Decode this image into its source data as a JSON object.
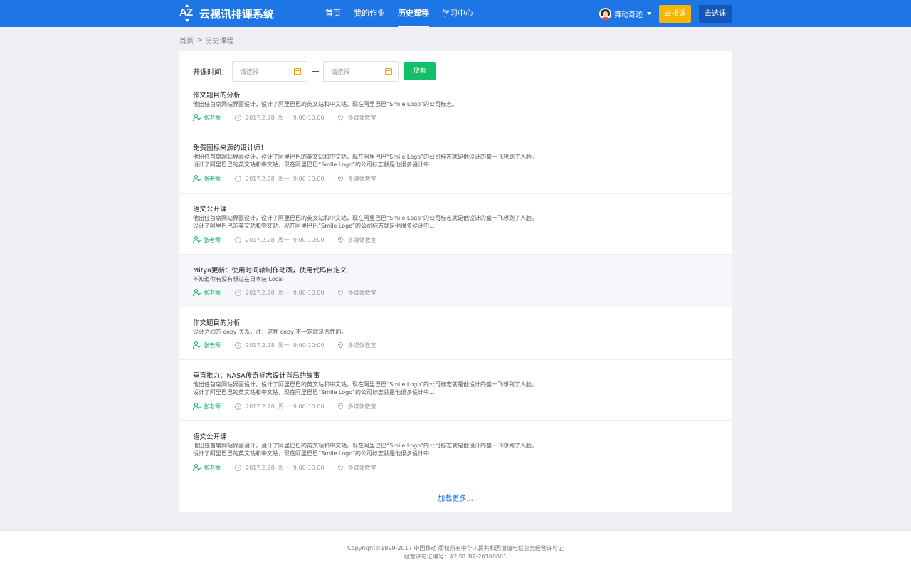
{
  "header": {
    "logo_text": "云视讯排课系统",
    "nav": [
      {
        "label": "首页",
        "active": false
      },
      {
        "label": "我的作业",
        "active": false
      },
      {
        "label": "历史课程",
        "active": true
      },
      {
        "label": "学习中心",
        "active": false
      }
    ],
    "user_name": "舞动奇迹",
    "arrange_button": "去排课",
    "select_button": "去选课",
    "colors": {
      "bar": "#1d75e6",
      "arrange": "#f7b500",
      "select": "#1557b8"
    }
  },
  "breadcrumb": {
    "home": "首页",
    "separator": ">",
    "current": "历史课程"
  },
  "filter": {
    "label": "开课时间：",
    "start_placeholder": "请选择",
    "end_placeholder": "请选择",
    "search_button": "搜索",
    "icon": "calendar-icon"
  },
  "courses": [
    {
      "title": "作文题目的分析",
      "desc_line1": "他出任首席网站界面设计，设计了阿里巴巴的英文站和中文站，现在阿里巴巴“Smile Logo”的公司标志。",
      "desc_line2": "",
      "teacher": "张老师",
      "date": "2017.2.28",
      "weekday": "周一",
      "time": "9:00-10:00",
      "place": "多媒体教室"
    },
    {
      "title": "免费图标来源的设计师！",
      "desc_line1": "他出任首席网站界面设计，设计了阿里巴巴的英文站和中文站，现在阿里巴巴“Smile Logo”的公司标志就是他设计的盛一飞想到了人脸。",
      "desc_line2": "设计了阿里巴巴的英文站和中文站，现在阿里巴巴“Smile Logo”的公司标志就是他很多设计中...",
      "teacher": "张老师",
      "date": "2017.2.28",
      "weekday": "周一",
      "time": "9:00-10:00",
      "place": "多媒体教室"
    },
    {
      "title": "语文公开课",
      "desc_line1": "他出任首席网站界面设计，设计了阿里巴巴的英文站和中文站，现在阿里巴巴“Smile Logo”的公司标志就是他设计的盛一飞想到了人脸。",
      "desc_line2": "设计了阿里巴巴的英文站和中文站，现在阿里巴巴“Smile Logo”的公司标志就是他很多设计中...",
      "teacher": "张老师",
      "date": "2017.2.28",
      "weekday": "周一",
      "time": "9:00-10:00",
      "place": "多媒体教室"
    },
    {
      "title": "Mitya更新：使用时间轴制作动画，使用代码自定义",
      "desc_line1": "不知道你有没有想过在日本装 Local",
      "desc_line2": "",
      "teacher": "张老师",
      "date": "2017.2.28",
      "weekday": "周一",
      "time": "9:00-10:00",
      "place": "多媒体教室"
    },
    {
      "title": "作文题目的分析",
      "desc_line1": "设计之间的 copy 关系，注：这种 copy 不一定就是恶性的。",
      "desc_line2": "",
      "teacher": "张老师",
      "date": "2017.2.28",
      "weekday": "周一",
      "time": "9:00-10:00",
      "place": "多媒体教室"
    },
    {
      "title": "垂直推力：NASA传奇标志设计背后的故事",
      "desc_line1": "他出任首席网站界面设计，设计了阿里巴巴的英文站和中文站，现在阿里巴巴“Smile Logo”的公司标志就是他设计的盛一飞想到了人脸。",
      "desc_line2": "设计了阿里巴巴的英文站和中文站，现在阿里巴巴“Smile Logo”的公司标志就是他很多设计中...",
      "teacher": "张老师",
      "date": "2017.2.28",
      "weekday": "周一",
      "time": "9:00-10:00",
      "place": "多媒体教室"
    },
    {
      "title": "语文公开课",
      "desc_line1": "他出任首席网站界面设计，设计了阿里巴巴的英文站和中文站，现在阿里巴巴“Smile Logo”的公司标志就是他设计的盛一飞想到了人脸。",
      "desc_line2": "设计了阿里巴巴的英文站和中文站，现在阿里巴巴“Smile Logo”的公司标志就是他很多设计中...",
      "teacher": "张老师",
      "date": "2017.2.28",
      "weekday": "周一",
      "time": "9:00-10:00",
      "place": "多媒体教室"
    }
  ],
  "load_more": "加载更多...",
  "footer": {
    "line1": "Copyright©1999-2017  中国移动  版权所有中华人民共和国增值电信业务经营许可证",
    "line2": "经营许可证编号：A2.B1.B2-20100001"
  }
}
